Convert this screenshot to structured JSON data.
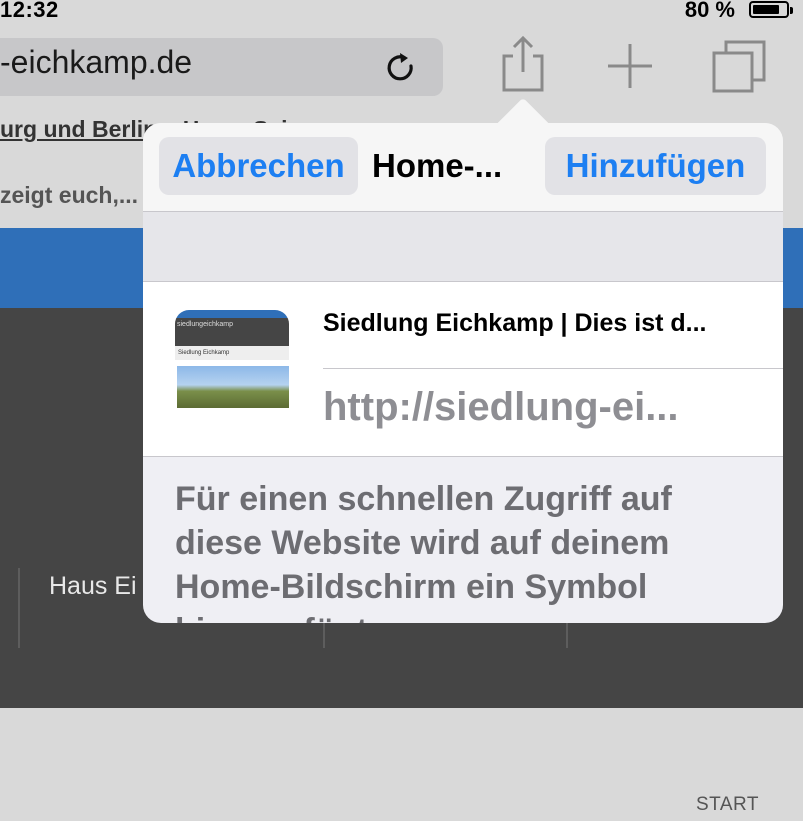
{
  "status_bar": {
    "time": "12:32",
    "battery_percent": "80 %",
    "battery_level": 0.8
  },
  "browser": {
    "url": "-eichkamp.de",
    "icons": {
      "reload": "reload-icon",
      "share": "share-icon",
      "new_tab": "plus-icon",
      "tabs": "tabs-icon"
    }
  },
  "page": {
    "heading_link": "urg und Berlin – Home Sei",
    "subtext": "zeigt euch,...",
    "menu_item": "Haus Ei",
    "footer_link": "START",
    "colors": {
      "band": "#2f6fb8",
      "dark": "#454545"
    }
  },
  "popover": {
    "cancel_label": "Abbrechen",
    "title": "Home-...",
    "add_label": "Hinzufügen",
    "site_title": "Siedlung Eichkamp | Dies ist d...",
    "site_url": "http://siedlung-ei...",
    "description": "Für einen schnellen Zugriff auf diese Website wird auf deinem Home-Bildschirm ein Symbol hinzugefügt.",
    "accent_color": "#1d7ff2",
    "thumbnail": {
      "logo_text": "siedlungeichkamp",
      "nav_text": "Siedlung Eichkamp"
    }
  }
}
